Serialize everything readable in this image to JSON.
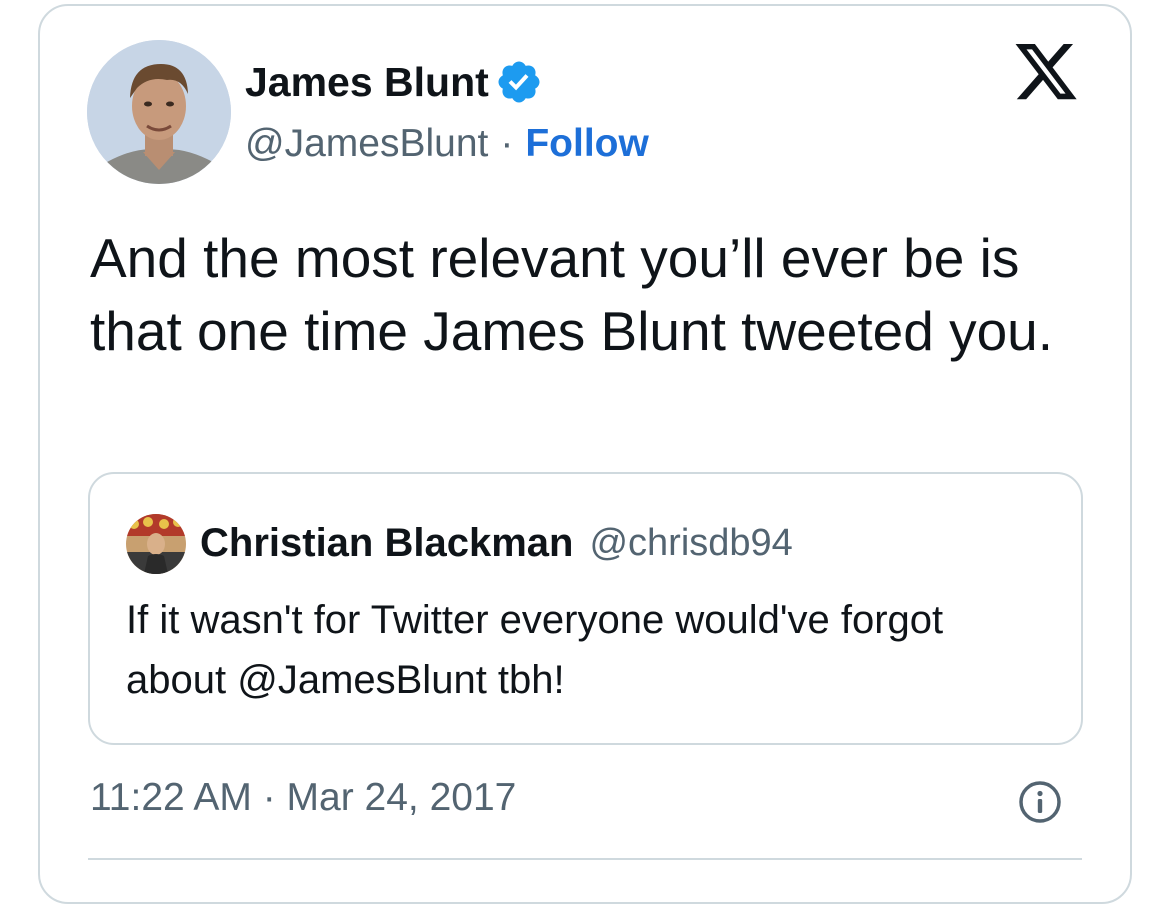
{
  "tweet": {
    "author_name": "James Blunt",
    "author_handle": "@JamesBlunt",
    "separator": "·",
    "follow_label": "Follow",
    "text": "And the most relevant you’ll ever be is that one time James Blunt tweeted you.",
    "timestamp": "11:22 AM · Mar 24, 2017"
  },
  "quoted_tweet": {
    "author_name": "Christian Blackman",
    "author_handle": "@chrisdb94",
    "text": "If it wasn't for Twitter everyone would've forgot about @JamesBlunt tbh!"
  },
  "icons": {
    "verified": "verified-badge-icon",
    "logo": "x-logo-icon",
    "info": "info-icon"
  },
  "colors": {
    "verified_blue": "#1d9bf0",
    "follow_blue": "#1d6fd8",
    "secondary_text": "#536471",
    "border": "#cfd9de"
  }
}
